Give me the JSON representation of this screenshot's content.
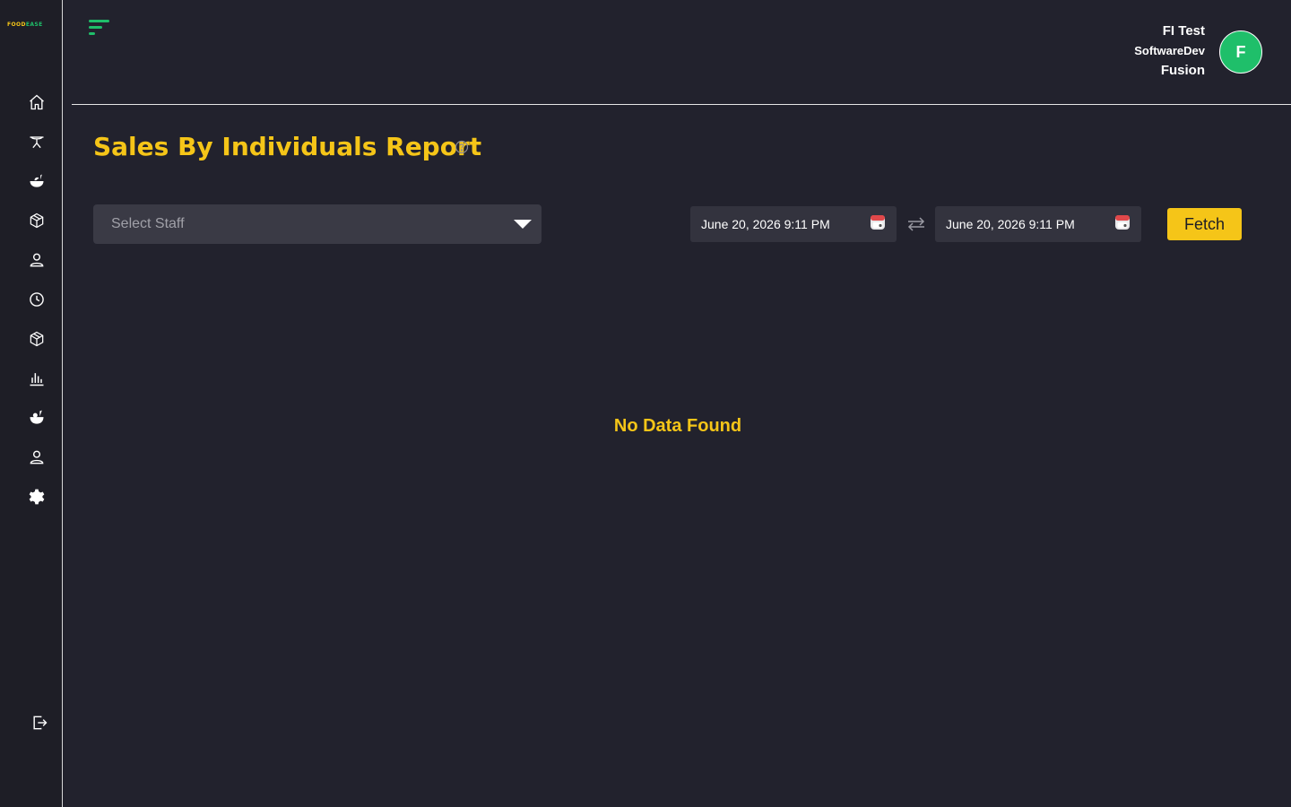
{
  "brand": {
    "logo_part1": "FOOD",
    "logo_part2": "EASE"
  },
  "sidebar": {
    "items": [
      {
        "name": "home",
        "icon": "home-icon"
      },
      {
        "name": "table",
        "icon": "table-icon"
      },
      {
        "name": "menu",
        "icon": "food-icon"
      },
      {
        "name": "inventory",
        "icon": "box-icon"
      },
      {
        "name": "customers",
        "icon": "user-icon"
      },
      {
        "name": "history",
        "icon": "clock-icon"
      },
      {
        "name": "products",
        "icon": "box-icon"
      },
      {
        "name": "reports",
        "icon": "bar-chart-icon"
      },
      {
        "name": "dishes",
        "icon": "food-icon"
      },
      {
        "name": "staff",
        "icon": "user-icon"
      },
      {
        "name": "settings",
        "icon": "gear-icon"
      }
    ],
    "logout_icon": "logout-icon"
  },
  "header": {
    "user_line1": "FI Test",
    "user_line2": "SoftwareDev",
    "user_line3": "Fusion",
    "avatar_initial": "F"
  },
  "page": {
    "title": "Sales By Individuals Report",
    "staff_placeholder": "Select Staff",
    "date_from": "June 20, 2026 9:11 PM",
    "date_to": "June 20, 2026 9:11 PM",
    "fetch_label": "Fetch",
    "empty_message": "No Data Found"
  },
  "colors": {
    "accent_yellow": "#f5c518",
    "accent_green": "#1fbf6a",
    "background": "#22222d",
    "sidebar": "#1e1e26"
  }
}
